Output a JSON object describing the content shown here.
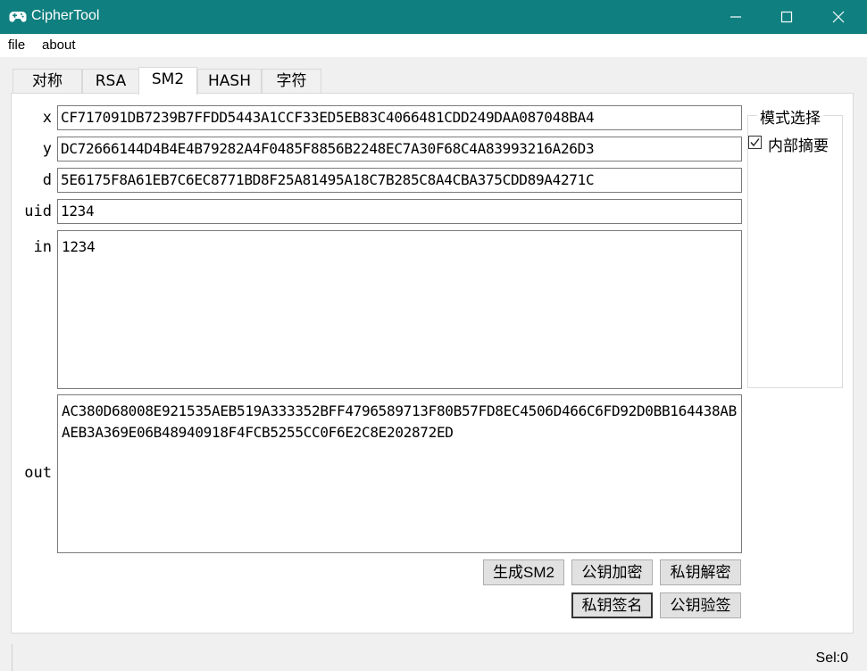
{
  "window": {
    "title": "CipherTool",
    "title_bar_color": "#0f7f7f"
  },
  "menu": [
    "file",
    "about"
  ],
  "tabs": [
    {
      "label": "对称",
      "active": false
    },
    {
      "label": "RSA",
      "active": false
    },
    {
      "label": "SM2",
      "active": true
    },
    {
      "label": "HASH",
      "active": false
    },
    {
      "label": "字符",
      "active": false
    }
  ],
  "fields": {
    "x": {
      "label": "x",
      "value": "CF717091DB7239B7FFDD5443A1CCF33ED5EB83C4066481CDD249DAA087048BA4"
    },
    "y": {
      "label": "y",
      "value": "DC72666144D4B4E4B79282A4F0485F8856B2248EC7A30F68C4A83993216A26D3"
    },
    "d": {
      "label": "d",
      "value": "5E6175F8A61EB7C6EC8771BD8F25A81495A18C7B285C8A4CBA375CDD89A4271C"
    },
    "uid": {
      "label": "uid",
      "value": "1234"
    },
    "in": {
      "label": "in",
      "value": "1234"
    },
    "out": {
      "label": "out",
      "value": "AC380D68008E921535AEB519A333352BFF4796589713F80B57FD8EC4506D466C6FD92D0BB164438ABAEB3A369E06B48940918F4FCB5255CC0F6E2C8E202872ED"
    }
  },
  "mode_group": {
    "title": "模式选择",
    "checkbox_label": "内部摘要",
    "checked": true
  },
  "buttons": {
    "generate": "生成SM2",
    "pub_encrypt": "公钥加密",
    "priv_decrypt": "私钥解密",
    "priv_sign": "私钥签名",
    "pub_verify": "公钥验签"
  },
  "status": {
    "selection": "Sel:0"
  }
}
